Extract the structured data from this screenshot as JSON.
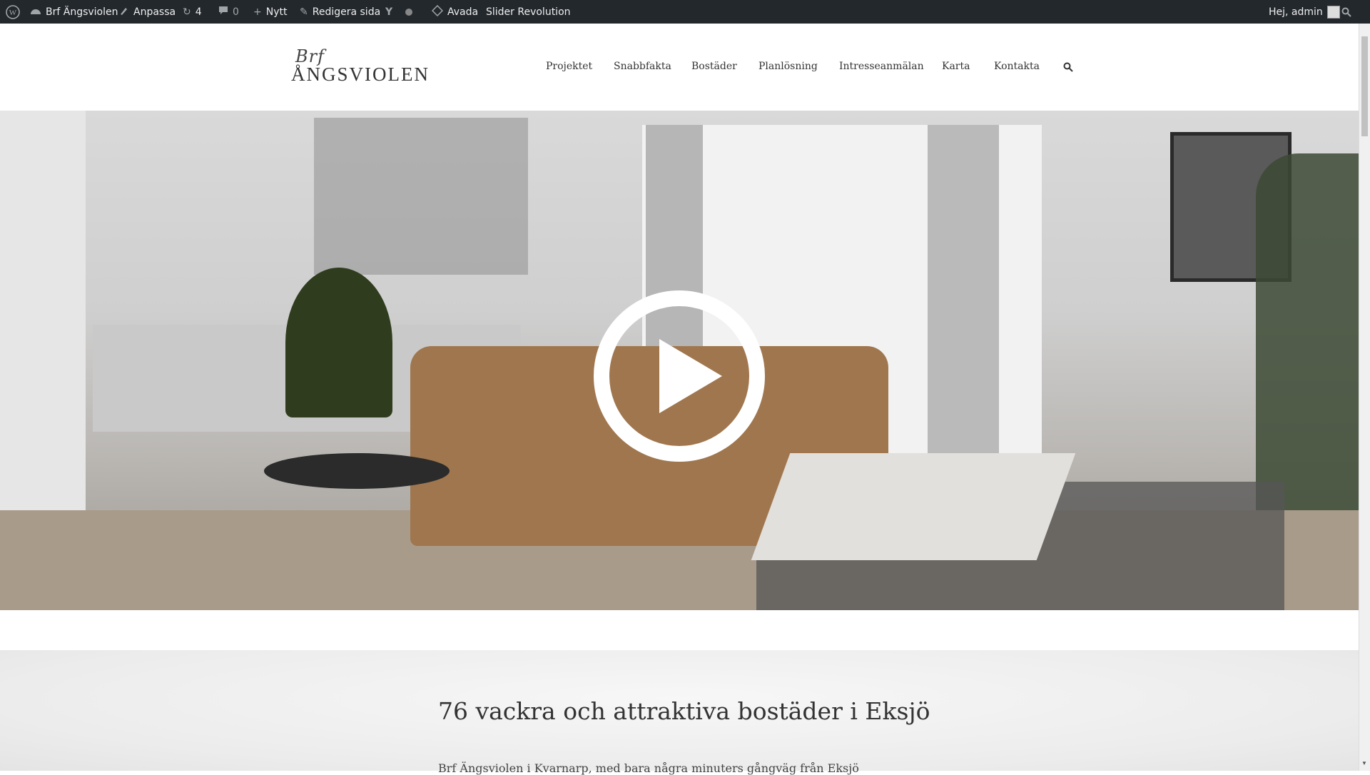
{
  "admin_bar": {
    "site_name": "Brf Ängsviolen",
    "customize": "Anpassa",
    "updates_count": "4",
    "comments_count": "0",
    "new": "Nytt",
    "edit_page": "Redigera sida",
    "avada": "Avada",
    "slider_revolution": "Slider Revolution",
    "greeting": "Hej, admin"
  },
  "header": {
    "logo_brf": "Brf",
    "logo_name": "ÅNGSVIOLEN",
    "nav": [
      "Projektet",
      "Snabbfakta",
      "Bostäder",
      "Planlösning",
      "Intresseanmälan",
      "Karta",
      "Kontakta"
    ]
  },
  "content": {
    "title": "76 vackra och attraktiva bostäder i Eksjö",
    "intro": "Brf Ängsviolen i Kvarnarp, med bara några minuters gångväg från Eksjö"
  },
  "colors": {
    "admin_bar_bg": "#23282d",
    "sofa": "#a0764e"
  }
}
